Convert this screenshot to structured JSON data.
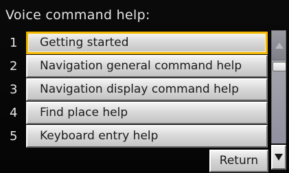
{
  "header": {
    "title": "Voice command help:"
  },
  "menu": {
    "items": [
      {
        "number": "1",
        "label": "Getting started",
        "selected": true
      },
      {
        "number": "2",
        "label": "Navigation general command help",
        "selected": false
      },
      {
        "number": "3",
        "label": "Navigation display command help",
        "selected": false
      },
      {
        "number": "4",
        "label": "Find place help",
        "selected": false
      },
      {
        "number": "5",
        "label": "Keyboard entry help",
        "selected": false
      }
    ]
  },
  "footer": {
    "return_label": "Return"
  },
  "scrollbar": {
    "up_icon": "triangle-up",
    "down_icon": "triangle-down"
  },
  "colors": {
    "selection_border": "#f2b600",
    "background": "#060606",
    "text_light": "#e6e6e6"
  }
}
